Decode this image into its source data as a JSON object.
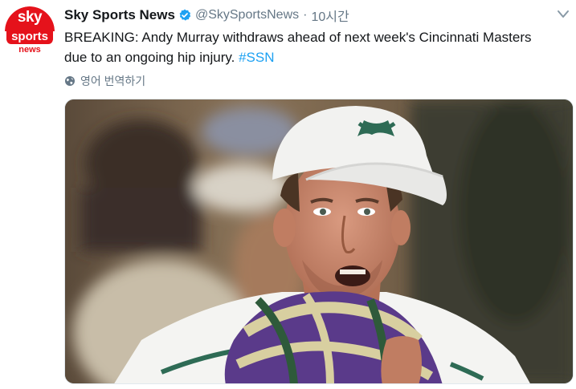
{
  "account": {
    "avatar_line1": "sky",
    "avatar_line2": "sports",
    "avatar_line3": "news",
    "display_name": "Sky Sports News",
    "handle": "@SkySportsNews",
    "separator": "·",
    "time": "10시간",
    "verified_icon": "verified-badge-icon"
  },
  "tweet": {
    "text": "BREAKING: Andy Murray withdraws ahead of next week's Cincinnati Masters due to an ongoing hip injury.",
    "hashtag": "#SSN",
    "translate_label": "영어 번역하기"
  },
  "media": {
    "cap_logo_icon": "under-armour-logo-icon"
  },
  "colors": {
    "accent": "#1da1f2",
    "brand_red": "#e5121b",
    "muted": "#657786"
  }
}
